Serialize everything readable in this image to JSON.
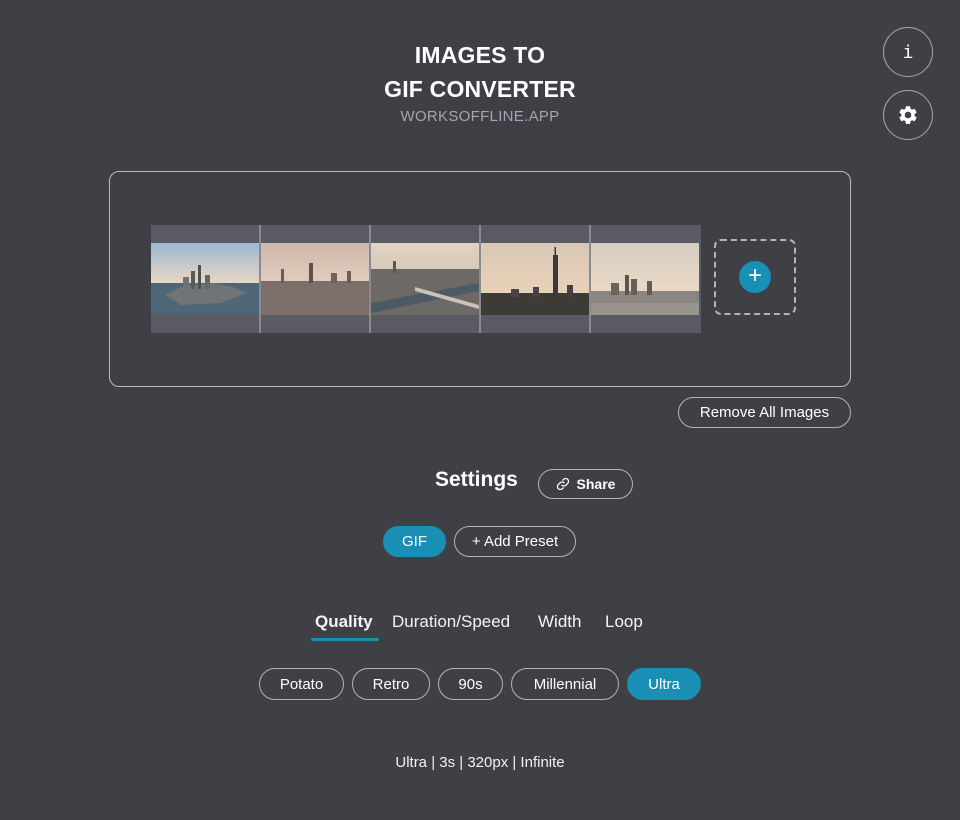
{
  "header": {
    "title_line1": "IMAGES TO",
    "title_line2": "GIF CONVERTER",
    "subtitle": "WORKSOFFLINE.APP"
  },
  "top_buttons": {
    "info_glyph": "i",
    "info_icon": "info-icon",
    "settings_icon": "gear-icon"
  },
  "images": {
    "thumbnails": [
      {
        "name": "city-aerial-1"
      },
      {
        "name": "city-aerial-2"
      },
      {
        "name": "city-aerial-3"
      },
      {
        "name": "city-aerial-4"
      },
      {
        "name": "city-aerial-5"
      }
    ],
    "add_glyph": "+",
    "remove_all_label": "Remove All Images"
  },
  "settings": {
    "title": "Settings",
    "share_label": "Share",
    "presets": [
      "GIF",
      "+ Add Preset"
    ],
    "active_preset": "GIF"
  },
  "tabs": [
    "Quality",
    "Duration/Speed",
    "Width",
    "Loop"
  ],
  "active_tab": "Quality",
  "quality_options": [
    "Potato",
    "Retro",
    "90s",
    "Millennial",
    "Ultra"
  ],
  "active_quality": "Ultra",
  "summary": "Ultra | 3s | 320px | Infinite",
  "colors": {
    "background": "#3f3f46",
    "accent": "#1a8fb5",
    "border": "#b3b3b9"
  }
}
